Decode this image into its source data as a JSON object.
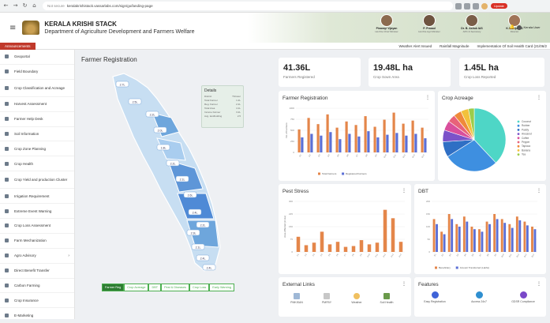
{
  "browser": {
    "not_secure": "Not secure",
    "url": "keralakrishistack.vassarlabs.com/sign/go/landing-page",
    "update": "Update"
  },
  "header": {
    "title": "KERALA KRISHI STACK",
    "subtitle": "Department of Agriculture Development and Farmers Welfare"
  },
  "officials": [
    {
      "name": "Pinarayi Vijayan",
      "role": "Hon'ble Chief Minister"
    },
    {
      "name": "P. Prasad",
      "role": "Hon'ble Agri Minister"
    },
    {
      "name": "Dr. B. Ashok IAS",
      "role": "APC & Secretary"
    },
    {
      "name": "K.S Anju IAS",
      "role": "Director"
    }
  ],
  "user": {
    "name": "Kerala User"
  },
  "ticker": {
    "label": "Announcements",
    "items": [
      "Weather Alert Issued",
      "Rainfall Magnitude",
      "Implementation Of Soil Health Card (21/06/2"
    ]
  },
  "sidebar": {
    "items": [
      "Geoportal",
      "Field Boundary",
      "Crop Classification and Acreage",
      "Harvest Assessment",
      "Farmer Help Desk",
      "Soil Information",
      "Crop Zone Planning",
      "Crop Health",
      "Crop Yield and production Cluster",
      "Irrigation Requirement",
      "Extreme Event Warning",
      "Crop Loss Assessment",
      "Farm Mechanization",
      "Agro Advisory",
      "Direct Benefit Transfer",
      "Carbon Farming",
      "Crop Insurance",
      "E-Marketing"
    ]
  },
  "map": {
    "title": "Farmer Registration",
    "details": {
      "title": "Details",
      "rows": [
        [
          "District",
          "Thrissur"
        ],
        [
          "Total Farmer",
          "1.2L"
        ],
        [
          "Reg. Farmer",
          "2.2L"
        ],
        [
          "Total Area",
          "4.1L"
        ],
        [
          "Income Farmer",
          "3.2L"
        ],
        [
          "Avg. landholding",
          "2.5"
        ]
      ]
    },
    "tabs": [
      "Farmer Reg",
      "Crop Acreage",
      "DBT",
      "Pest & Diseases",
      "Crop Loss",
      "Early Warning"
    ],
    "labels": [
      "2.7L",
      "2.5L",
      "2.2L",
      "2.0L",
      "1.8L",
      "2.2L",
      "2.1L",
      "2.6L",
      "2.4L",
      "2.2L",
      "2.3L",
      "2.1L",
      "2.4L",
      "2.4L"
    ]
  },
  "kpis": [
    {
      "value": "41.36L",
      "label": "Farmers Registered"
    },
    {
      "value": "19.48L ha",
      "label": "Crop Sown Area"
    },
    {
      "value": "1.45L ha",
      "label": "Crop Loss Reported"
    }
  ],
  "cards": {
    "farmer_reg": "Farmer Registration",
    "crop_acreage": "Crop Acreage",
    "pest": "Pest Stress",
    "dbt": "DBT",
    "links": "External Links",
    "features": "Features"
  },
  "links": [
    "PMKISAN",
    "PMFBY",
    "Weather",
    "Soil Health"
  ],
  "features": [
    "Easy Registration",
    "Access 24x7",
    "GDSR Compliance"
  ],
  "colors": {
    "bar_orange": "#e4864a",
    "bar_blue": "#5b6fd6",
    "kerala_map": "#b9d6ef"
  },
  "chart_data": [
    {
      "type": "bar",
      "title": "Farmer Registration",
      "ylabel": "No of Farmers",
      "ylim": [
        0,
        1000
      ],
      "categories": [
        "D1",
        "D2",
        "D3",
        "D4",
        "D5",
        "D6",
        "D7",
        "D8",
        "D9",
        "D10",
        "D11",
        "D12",
        "D13",
        "D14"
      ],
      "series": [
        {
          "name": "Total Farmers",
          "values": [
            520,
            780,
            640,
            860,
            560,
            700,
            620,
            820,
            580,
            740,
            900,
            650,
            720,
            560
          ]
        },
        {
          "name": "Registered Farmers",
          "values": [
            340,
            420,
            380,
            460,
            300,
            420,
            360,
            480,
            340,
            400,
            440,
            380,
            420,
            320
          ]
        }
      ]
    },
    {
      "type": "pie",
      "title": "Crop Acreage",
      "categories": [
        "Coconut",
        "Rubber",
        "Paddy",
        "Arecanut",
        "Coffee",
        "Pepper",
        "Tapioca",
        "Banana",
        "Tea"
      ],
      "values": [
        38,
        28,
        8,
        6,
        5,
        4,
        4,
        4,
        3
      ]
    },
    {
      "type": "bar",
      "title": "Pest Stress",
      "ylabel": "Area Affected (in Ha)",
      "ylim": [
        0,
        300
      ],
      "categories": [
        "P1",
        "P2",
        "P3",
        "P4",
        "P5",
        "P6",
        "P7",
        "P8",
        "P9",
        "P10",
        "P11",
        "P12",
        "P13",
        "P14"
      ],
      "values": [
        90,
        40,
        55,
        120,
        45,
        60,
        30,
        35,
        70,
        45,
        55,
        250,
        200,
        60
      ]
    },
    {
      "type": "bar",
      "title": "DBT",
      "ylim": [
        0,
        200
      ],
      "categories": [
        "B1",
        "B2",
        "B3",
        "B4",
        "B5",
        "B6",
        "B7",
        "B8",
        "B9",
        "B10",
        "B11",
        "B12",
        "B13",
        "B14"
      ],
      "series": [
        {
          "name": "Beneficiary",
          "values": [
            130,
            80,
            150,
            110,
            140,
            100,
            90,
            120,
            150,
            130,
            110,
            140,
            120,
            100
          ]
        },
        {
          "name": "Amount Transferred (Lakhs)",
          "values": [
            110,
            70,
            130,
            100,
            120,
            90,
            80,
            110,
            130,
            115,
            95,
            125,
            105,
            90
          ]
        }
      ]
    }
  ]
}
